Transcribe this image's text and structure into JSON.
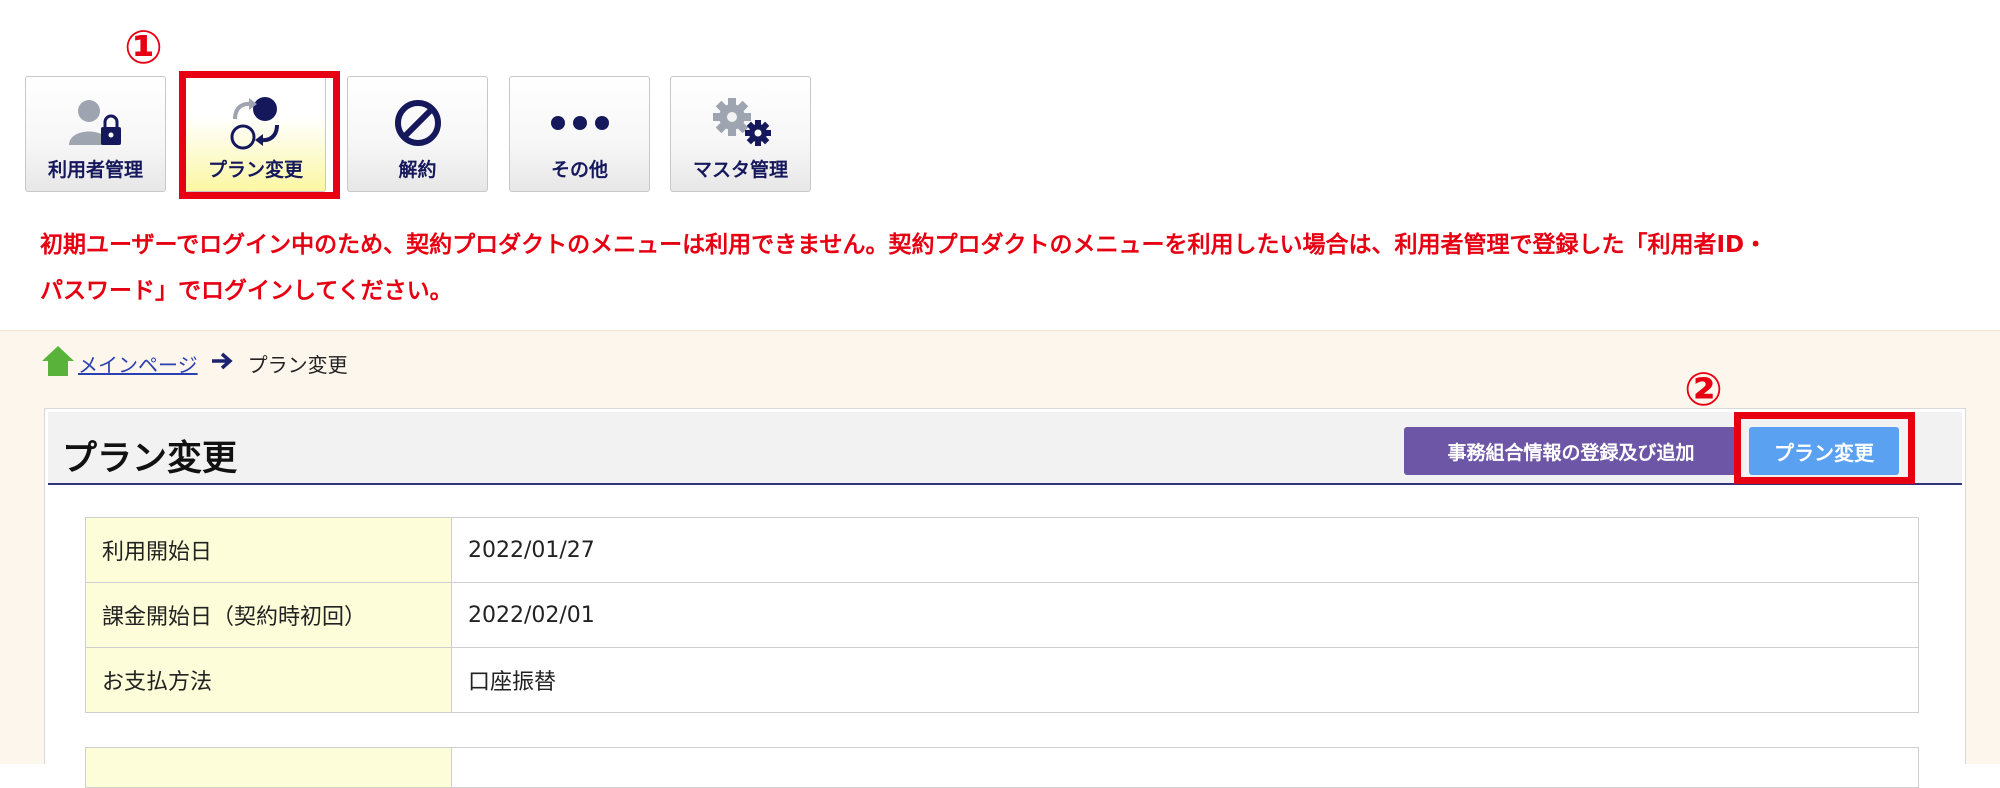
{
  "toolbar": {
    "items": [
      {
        "label": "利用者管理",
        "icon": "user-lock-icon"
      },
      {
        "label": "プラン変更",
        "icon": "plan-change-icon",
        "active": true
      },
      {
        "label": "解約",
        "icon": "prohibited-icon"
      },
      {
        "label": "その他",
        "icon": "more-dots-icon"
      },
      {
        "label": "マスタ管理",
        "icon": "gears-icon"
      }
    ]
  },
  "annotations": {
    "step1": "①",
    "step2": "②"
  },
  "notice": {
    "line1": "初期ユーザーでログイン中のため、契約プロダクトのメニューは利用できません。契約プロダクトのメニューを利用したい場合は、利用者管理で登録した「利用者ID・",
    "line2": "パスワード」でログインしてください。"
  },
  "breadcrumb": {
    "home": "メインページ",
    "current": "プラン変更"
  },
  "panel": {
    "title": "プラン変更",
    "register_button": "事務組合情報の登録及び追加",
    "plan_button": "プラン変更",
    "rows": [
      {
        "label": "利用開始日",
        "value": "2022/01/27"
      },
      {
        "label": "課金開始日（契約時初回）",
        "value": "2022/02/01"
      },
      {
        "label": "お支払方法",
        "value": "口座振替"
      }
    ]
  },
  "colors": {
    "accent_red": "#e60012",
    "navy": "#16185c",
    "purple_button": "#6e56a7",
    "blue_button": "#5aa1f2",
    "label_cell": "#fdfdd9"
  }
}
